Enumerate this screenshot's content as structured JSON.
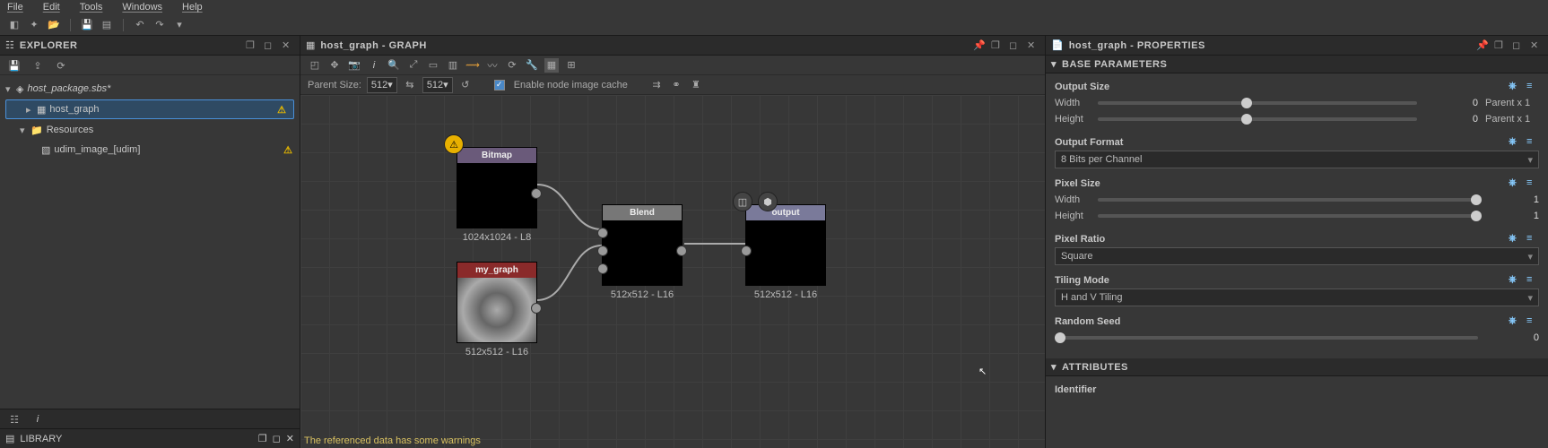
{
  "menubar": [
    "File",
    "Edit",
    "Tools",
    "Windows",
    "Help"
  ],
  "explorer": {
    "title": "EXPLORER",
    "package": "host_package.sbs*",
    "graph": "host_graph",
    "resources_label": "Resources",
    "resource_item": "udim_image_[udim]",
    "library": "LIBRARY"
  },
  "graph": {
    "tab_title": "host_graph - GRAPH",
    "parent_size_label": "Parent Size:",
    "parent_size_a": "512",
    "parent_size_b": "512",
    "cache_label": "Enable node image cache",
    "nodes": {
      "bitmap": {
        "title": "Bitmap",
        "caption": "1024x1024 - L8"
      },
      "mygraph": {
        "title": "my_graph",
        "caption": "512x512 - L16"
      },
      "blend": {
        "title": "Blend",
        "caption": "512x512 - L16"
      },
      "output": {
        "title": "output",
        "caption": "512x512 - L16"
      }
    },
    "status": "The referenced data has some warnings"
  },
  "props": {
    "tab_title": "host_graph - PROPERTIES",
    "section_base": "BASE PARAMETERS",
    "output_size": {
      "label": "Output Size",
      "width": "Width",
      "height": "Height",
      "wval": "0",
      "hval": "0",
      "winh": "Parent x 1",
      "hinh": "Parent x 1"
    },
    "output_format": {
      "label": "Output Format",
      "value": "8 Bits per Channel"
    },
    "pixel_size": {
      "label": "Pixel Size",
      "width": "Width",
      "height": "Height",
      "wval": "1",
      "hval": "1"
    },
    "pixel_ratio": {
      "label": "Pixel Ratio",
      "value": "Square"
    },
    "tiling": {
      "label": "Tiling Mode",
      "value": "H and V Tiling"
    },
    "seed": {
      "label": "Random Seed",
      "value": "0"
    },
    "section_attr": "ATTRIBUTES",
    "identifier": "Identifier"
  }
}
